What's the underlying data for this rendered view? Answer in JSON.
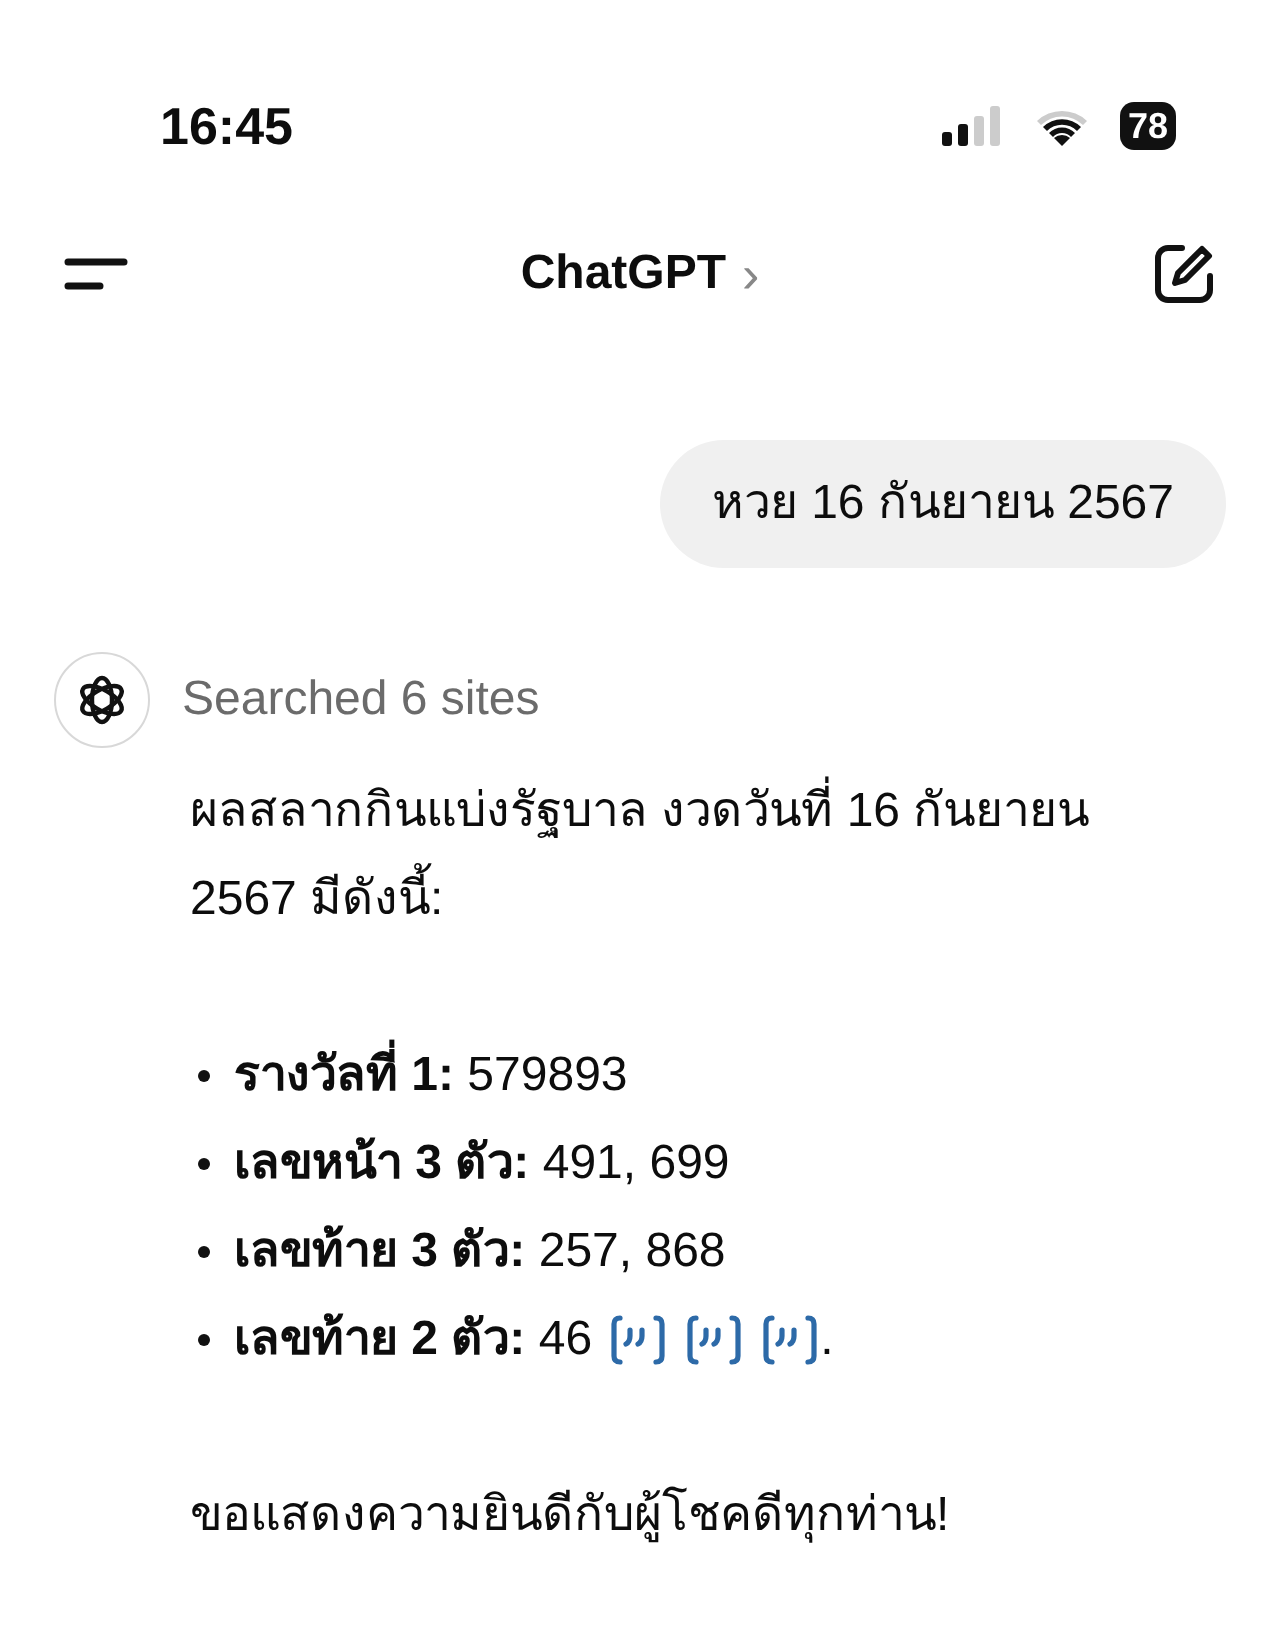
{
  "status_bar": {
    "time": "16:45",
    "battery": "78"
  },
  "header": {
    "title": "ChatGPT",
    "chevron": "›"
  },
  "messages": [
    {
      "kind": "user",
      "text": "หวย 16 กันยายน 2567"
    },
    {
      "kind": "assistant",
      "status": "Searched 6 sites",
      "intro": "ผลสลากกินแบ่งรัฐบาล งวดวันที่ 16 กันยายน 2567 มีดังนี้:",
      "bullets": [
        {
          "text": "**รางวัลที่ 1:** 579893"
        },
        {
          "text": "**เลขหน้า 3 ตัว:** 491, 699"
        },
        {
          "text": "**เลขท้าย 3 ตัว:** 257, 868"
        },
        {
          "text": "**เลขท้าย 2 ตัว:** 46",
          "citations": [
            {
              "kind": "quote"
            },
            {
              "kind": "quote"
            },
            {
              "kind": "quote"
            }
          ],
          "trailing": "."
        }
      ],
      "outro": "ขอแสดงความยินดีกับผู้โชคดีทุกท่าน!"
    }
  ]
}
